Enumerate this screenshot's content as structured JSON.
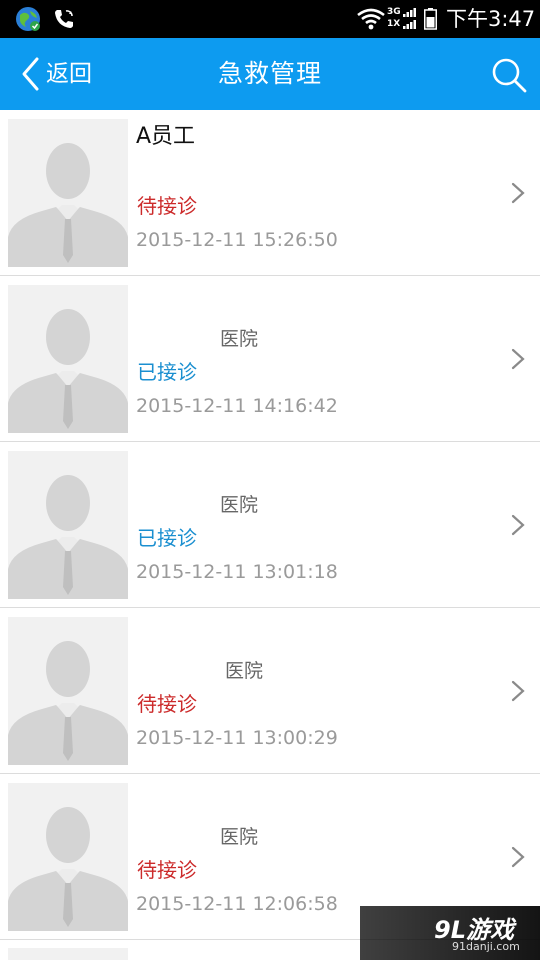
{
  "status_bar": {
    "time": "下午3:47",
    "net_top": "3G",
    "net_bottom": "1X",
    "icons": [
      "globe-icon",
      "phone-sync-icon",
      "wifi-icon",
      "signal-icon",
      "battery-icon"
    ]
  },
  "app_bar": {
    "back_label": "返回",
    "title": "急救管理",
    "color": "#0d9bf0"
  },
  "records": [
    {
      "title": "A员工",
      "hospital": "",
      "status": "待接诊",
      "status_type": "pending",
      "time": "2015-12-11 15:26:50"
    },
    {
      "title": "",
      "hospital": "医院",
      "status": "已接诊",
      "status_type": "accepted",
      "time": "2015-12-11 14:16:42"
    },
    {
      "title": "",
      "hospital": "医院",
      "status": "已接诊",
      "status_type": "accepted",
      "time": "2015-12-11 13:01:18"
    },
    {
      "title": "",
      "hospital": "医院",
      "status": "待接诊",
      "status_type": "pending",
      "time": "2015-12-11 13:00:29"
    },
    {
      "title": "",
      "hospital": "医院",
      "status": "待接诊",
      "status_type": "pending",
      "time": "2015-12-11 12:06:58"
    }
  ],
  "colors": {
    "pending": "#cc2b2b",
    "accepted": "#1b8fd0",
    "time": "#9a9a9a"
  },
  "watermark": {
    "logo": "9L游戏",
    "site": "91danji.com"
  }
}
